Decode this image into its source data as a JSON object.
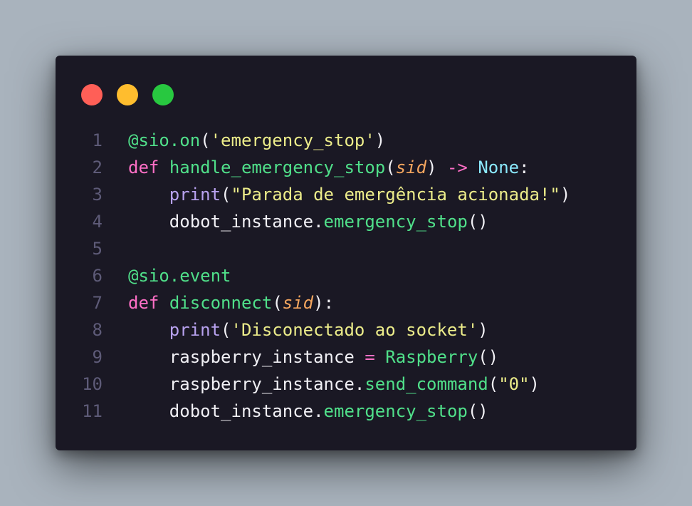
{
  "window": {
    "traffic_lights": [
      {
        "name": "close",
        "color": "#ff5f57"
      },
      {
        "name": "minimize",
        "color": "#ffbd2e"
      },
      {
        "name": "zoom",
        "color": "#28c840"
      }
    ]
  },
  "colors": {
    "background": "#a9b3bd",
    "editor": "#1a1824",
    "line_number": "#5e5b78",
    "decorator": "#50e08a",
    "string": "#ecec8a",
    "keyword": "#ff6fc6",
    "function": "#50e08a",
    "parameter": "#f5a65f",
    "type": "#8be9fd",
    "builtin": "#b8a2ef"
  },
  "code": {
    "lines": [
      {
        "number": "1",
        "tokens": [
          {
            "t": "@sio.on",
            "k": "deco"
          },
          {
            "t": "(",
            "k": "plain"
          },
          {
            "t": "'emergency_stop'",
            "k": "str"
          },
          {
            "t": ")",
            "k": "plain"
          }
        ]
      },
      {
        "number": "2",
        "tokens": [
          {
            "t": "def",
            "k": "kw"
          },
          {
            "t": " ",
            "k": "plain"
          },
          {
            "t": "handle_emergency_stop",
            "k": "fn"
          },
          {
            "t": "(",
            "k": "plain"
          },
          {
            "t": "sid",
            "k": "param"
          },
          {
            "t": ") ",
            "k": "plain"
          },
          {
            "t": "->",
            "k": "op"
          },
          {
            "t": " ",
            "k": "plain"
          },
          {
            "t": "None",
            "k": "type"
          },
          {
            "t": ":",
            "k": "plain"
          }
        ]
      },
      {
        "number": "3",
        "tokens": [
          {
            "t": "    ",
            "k": "plain"
          },
          {
            "t": "print",
            "k": "builtin"
          },
          {
            "t": "(",
            "k": "plain"
          },
          {
            "t": "\"Parada de emergência acionada!\"",
            "k": "str"
          },
          {
            "t": ")",
            "k": "plain"
          }
        ]
      },
      {
        "number": "4",
        "tokens": [
          {
            "t": "    dobot_instance.",
            "k": "plain"
          },
          {
            "t": "emergency_stop",
            "k": "fn"
          },
          {
            "t": "()",
            "k": "plain"
          }
        ]
      },
      {
        "number": "5",
        "tokens": []
      },
      {
        "number": "6",
        "tokens": [
          {
            "t": "@sio.event",
            "k": "deco"
          }
        ]
      },
      {
        "number": "7",
        "tokens": [
          {
            "t": "def",
            "k": "kw"
          },
          {
            "t": " ",
            "k": "plain"
          },
          {
            "t": "disconnect",
            "k": "fn"
          },
          {
            "t": "(",
            "k": "plain"
          },
          {
            "t": "sid",
            "k": "param"
          },
          {
            "t": "):",
            "k": "plain"
          }
        ]
      },
      {
        "number": "8",
        "tokens": [
          {
            "t": "    ",
            "k": "plain"
          },
          {
            "t": "print",
            "k": "builtin"
          },
          {
            "t": "(",
            "k": "plain"
          },
          {
            "t": "'Disconectado ao socket'",
            "k": "str"
          },
          {
            "t": ")",
            "k": "plain"
          }
        ]
      },
      {
        "number": "9",
        "tokens": [
          {
            "t": "    raspberry_instance ",
            "k": "plain"
          },
          {
            "t": "=",
            "k": "op"
          },
          {
            "t": " ",
            "k": "plain"
          },
          {
            "t": "Raspberry",
            "k": "fn"
          },
          {
            "t": "()",
            "k": "plain"
          }
        ]
      },
      {
        "number": "10",
        "tokens": [
          {
            "t": "    raspberry_instance.",
            "k": "plain"
          },
          {
            "t": "send_command",
            "k": "fn"
          },
          {
            "t": "(",
            "k": "plain"
          },
          {
            "t": "\"0\"",
            "k": "str"
          },
          {
            "t": ")",
            "k": "plain"
          }
        ]
      },
      {
        "number": "11",
        "tokens": [
          {
            "t": "    dobot_instance.",
            "k": "plain"
          },
          {
            "t": "emergency_stop",
            "k": "fn"
          },
          {
            "t": "()",
            "k": "plain"
          }
        ]
      }
    ]
  }
}
